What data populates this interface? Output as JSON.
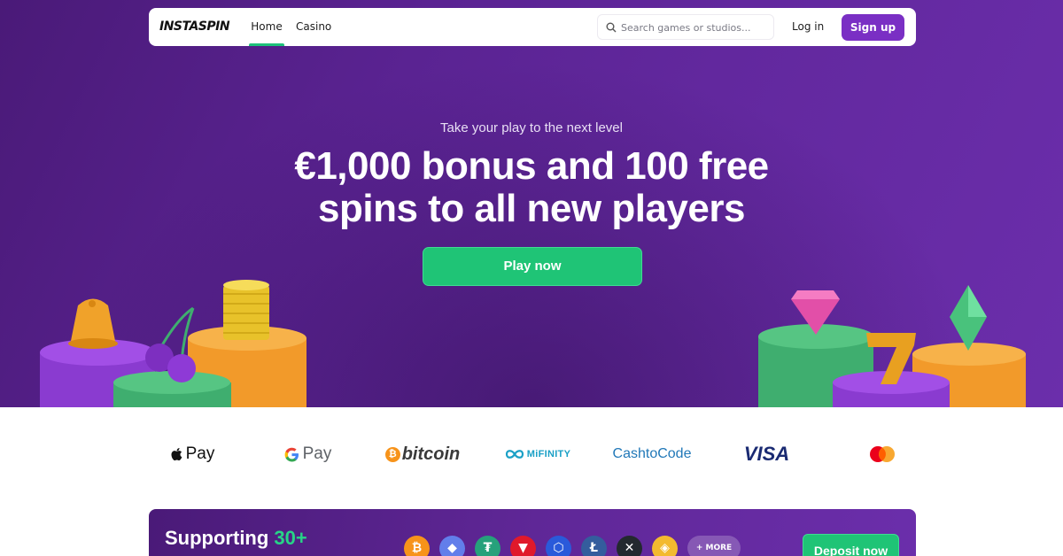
{
  "nav": {
    "logo": "INSTASPIN",
    "links": [
      {
        "label": "Home",
        "active": true
      },
      {
        "label": "Casino",
        "active": false
      }
    ],
    "search_placeholder": "Search games or studios...",
    "login_label": "Log in",
    "signup_label": "Sign up"
  },
  "hero": {
    "tagline": "Take your play to the next level",
    "headline_line1": "€1,000 bonus and 100 free",
    "headline_line2": "spins to all new players",
    "cta_label": "Play now"
  },
  "payments": {
    "apple_pay": "Pay",
    "google_pay": "Pay",
    "bitcoin": "bitcoin",
    "mifinity": "MiFINITY",
    "cashtocode": "CashtoCode",
    "visa": "VISA",
    "mastercard_icon": "mastercard-icon"
  },
  "crypto_banner": {
    "title_prefix": "Supporting ",
    "title_highlight": "30+",
    "coins": [
      "bitcoin-icon",
      "ethereum-icon",
      "tether-icon",
      "tron-icon",
      "chainlink-icon",
      "litecoin-icon",
      "xrp-icon",
      "bnb-icon"
    ],
    "more_label": "+ MORE",
    "deposit_label": "Deposit now"
  },
  "colors": {
    "hero_purple": "#5a2392",
    "accent_green": "#1fc476",
    "signup_purple": "#7a2fc4"
  }
}
